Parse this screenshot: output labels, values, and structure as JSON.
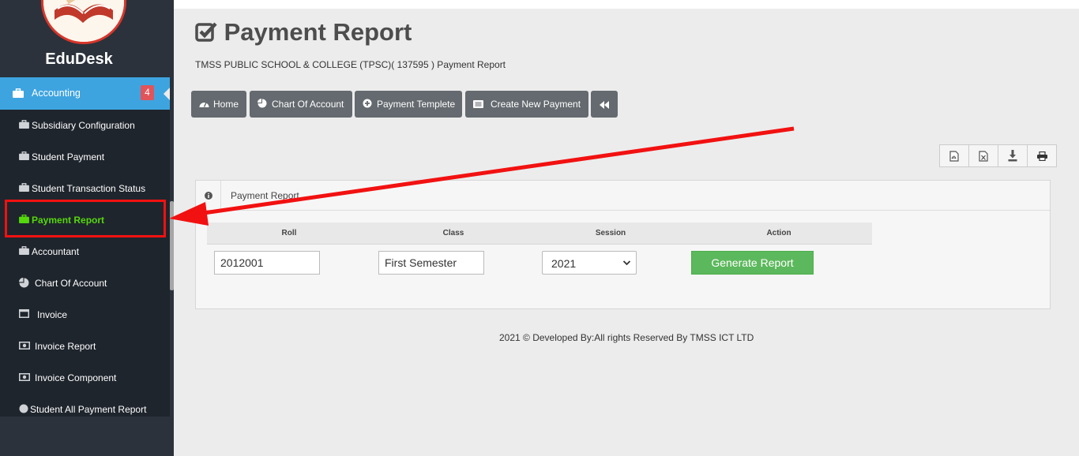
{
  "sidebar": {
    "brand": "EduDesk",
    "section": {
      "label": "Accounting",
      "badge": "4"
    },
    "items": [
      {
        "label": "Subsidiary Configuration",
        "icon": "briefcase-icon"
      },
      {
        "label": "Student Payment",
        "icon": "briefcase-icon"
      },
      {
        "label": "Student Transaction Status",
        "icon": "briefcase-icon"
      },
      {
        "label": "Payment Report",
        "icon": "briefcase-icon",
        "active": true
      },
      {
        "label": "Accountant",
        "icon": "briefcase-icon"
      },
      {
        "label": "Chart Of Account",
        "icon": "pie-chart-icon"
      },
      {
        "label": "Invoice",
        "icon": "window-icon"
      },
      {
        "label": "Invoice Report",
        "icon": "money-icon"
      },
      {
        "label": "Invoice Component",
        "icon": "money-icon"
      },
      {
        "label": "Student All Payment Report",
        "icon": "circle-icon"
      }
    ]
  },
  "header": {
    "title": "Payment Report",
    "subtitle": "TMSS PUBLIC SCHOOL & COLLEGE (TPSC)( 137595 ) Payment Report"
  },
  "toolbar": {
    "home": "Home",
    "chart_of_account": "Chart Of Account",
    "payment_template": "Payment Templete",
    "create_payment": "Create New Payment"
  },
  "export_icons": [
    "pdf-icon",
    "excel-icon",
    "download-icon",
    "print-icon"
  ],
  "panel": {
    "title": "Payment Report",
    "columns": [
      "Roll",
      "Class",
      "Session",
      "Action"
    ],
    "roll_value": "2012001",
    "class_value": "First Semester",
    "session_value": "2021",
    "generate_label": "Generate Report"
  },
  "footer": "2021 © Developed By:All rights Reserved By TMSS ICT LTD",
  "colors": {
    "accent": "#3ea4e0",
    "active_item": "#55d80c",
    "generate": "#5cb85c",
    "annotation": "#f21111",
    "sidebar": "#2b323c"
  }
}
